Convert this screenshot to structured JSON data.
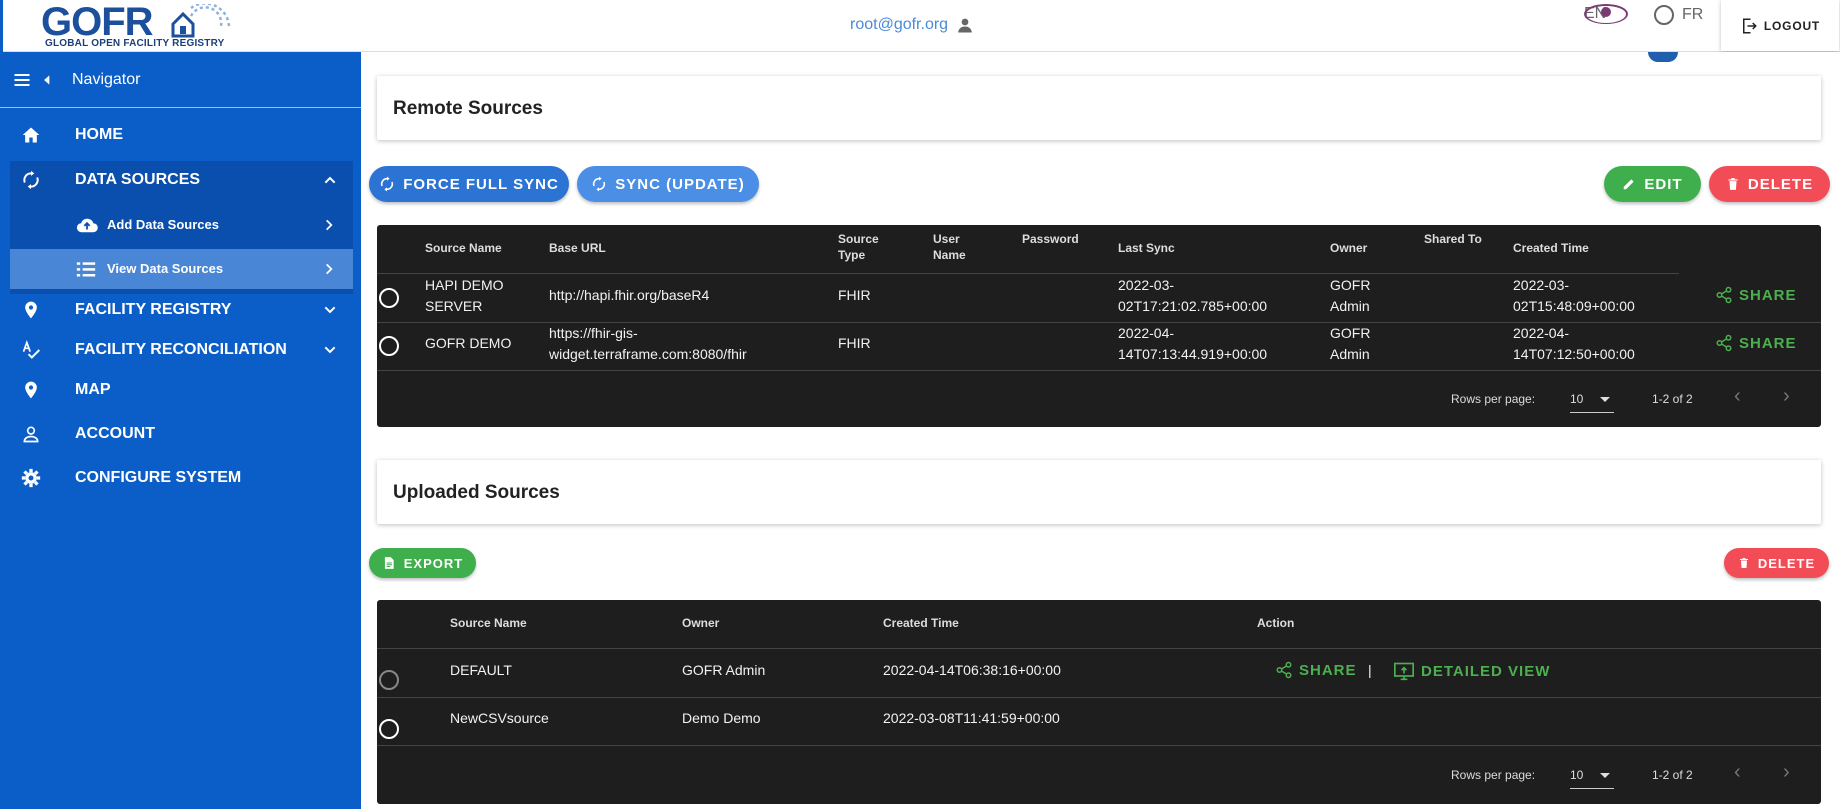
{
  "header": {
    "logo_text": "GOFR",
    "logo_subtitle": "GLOBAL OPEN FACILITY REGISTRY",
    "user_email": "root@gofr.org",
    "languages": [
      {
        "label": "EN",
        "selected": true
      },
      {
        "label": "FR",
        "selected": false
      }
    ],
    "logout_label": "LOGOUT"
  },
  "sidebar": {
    "title": "Navigator",
    "items": [
      {
        "label": "HOME",
        "icon": "home-icon"
      },
      {
        "label": "DATA SOURCES",
        "icon": "sync-icon",
        "expanded": true
      },
      {
        "label": "FACILITY REGISTRY",
        "icon": "location-pin-icon"
      },
      {
        "label": "FACILITY RECONCILIATION",
        "icon": "spellcheck-icon"
      },
      {
        "label": "MAP",
        "icon": "location-pin-icon"
      },
      {
        "label": "ACCOUNT",
        "icon": "person-icon"
      },
      {
        "label": "CONFIGURE SYSTEM",
        "icon": "gear-icon"
      }
    ],
    "subitems": [
      {
        "label": "Add Data Sources",
        "icon": "cloud-upload-icon"
      },
      {
        "label": "View Data Sources",
        "icon": "list-icon",
        "active": true
      }
    ]
  },
  "remote": {
    "title": "Remote Sources",
    "force_sync_label": "FORCE FULL SYNC",
    "sync_update_label": "SYNC (UPDATE)",
    "edit_label": "EDIT",
    "delete_label": "DELETE",
    "columns": {
      "source_name": "Source Name",
      "base_url": "Base URL",
      "source_type_1": "Source",
      "source_type_2": "Type",
      "user_name_1": "User",
      "user_name_2": "Name",
      "password": "Password",
      "last_sync": "Last Sync",
      "owner": "Owner",
      "shared_to": "Shared To",
      "created_time": "Created Time"
    },
    "rows": [
      {
        "name_1": "HAPI DEMO",
        "name_2": "SERVER",
        "url_1": "http://hapi.fhir.org/baseR4",
        "url_2": "",
        "type": "FHIR",
        "last_sync_1": "2022-03-",
        "last_sync_2": "02T17:21:02.785+00:00",
        "owner_1": "GOFR",
        "owner_2": "Admin",
        "created_1": "2022-03-",
        "created_2": "02T15:48:09+00:00",
        "action": "SHARE"
      },
      {
        "name_1": "GOFR DEMO",
        "name_2": "",
        "url_1": "https://fhir-gis-",
        "url_2": "widget.terraframe.com:8080/fhir",
        "type": "FHIR",
        "last_sync_1": "2022-04-",
        "last_sync_2": "14T07:13:44.919+00:00",
        "owner_1": "GOFR",
        "owner_2": "Admin",
        "created_1": "2022-04-",
        "created_2": "14T07:12:50+00:00",
        "action": "SHARE"
      }
    ],
    "rows_per_page_label": "Rows per page:",
    "rows_per_page": "10",
    "range": "1-2 of 2"
  },
  "uploaded": {
    "title": "Uploaded Sources",
    "export_label": "EXPORT",
    "delete_label": "DELETE",
    "columns": {
      "source_name": "Source Name",
      "owner": "Owner",
      "created_time": "Created Time",
      "action": "Action"
    },
    "rows": [
      {
        "name": "DEFAULT",
        "owner": "GOFR Admin",
        "created": "2022-04-14T06:38:16+00:00",
        "share": "SHARE",
        "separator": "|",
        "detail": "DETAILED VIEW"
      },
      {
        "name": "NewCSVsource",
        "owner": "Demo Demo",
        "created": "2022-03-08T11:41:59+00:00"
      }
    ],
    "rows_per_page_label": "Rows per page:",
    "rows_per_page": "10",
    "range": "1-2 of 2"
  },
  "colors": {
    "sidebar": "#0b5ec7",
    "sidebar_group": "#0a4fae",
    "sidebar_active": "#4a86d6",
    "primary": "#2c74d4",
    "success": "#3fae4c",
    "danger": "#f24d56",
    "table_bg": "#1e1e1e"
  }
}
